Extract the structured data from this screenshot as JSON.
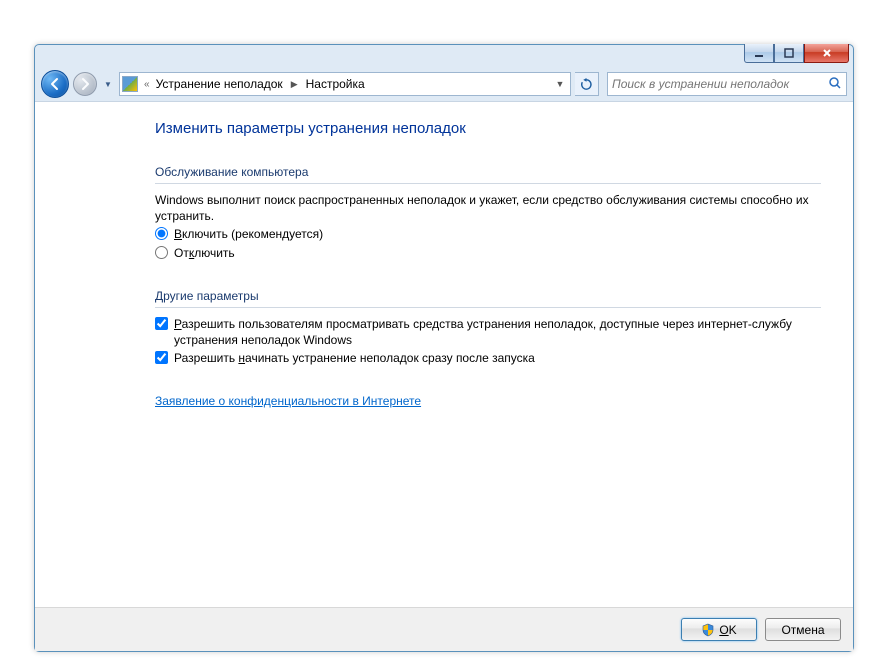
{
  "breadcrumb": {
    "prefix": "«",
    "part1": "Устранение неполадок",
    "part2": "Настройка"
  },
  "search": {
    "placeholder": "Поиск в устранении неполадок"
  },
  "page": {
    "title": "Изменить параметры устранения неполадок"
  },
  "section1": {
    "header": "Обслуживание компьютера",
    "description": "Windows выполнит поиск распространенных неполадок и укажет, если средство обслуживания системы способно их устранить.",
    "radio_on_prefix": "В",
    "radio_on_rest": "ключить (рекомендуется)",
    "radio_off_prefix": "От",
    "radio_off_accessor": "к",
    "radio_off_rest": "лючить"
  },
  "section2": {
    "header": "Другие параметры",
    "check1_prefix": "Р",
    "check1_rest": "азрешить пользователям просматривать средства устранения неполадок, доступные через интернет-службу устранения неполадок Windows",
    "check2_prefix": "Разрешить ",
    "check2_accessor": "н",
    "check2_rest": "ачинать устранение неполадок сразу после запуска"
  },
  "privacy_link": "Заявление о конфиденциальности в Интернете",
  "footer": {
    "ok_accessor": "O",
    "ok_rest": "K",
    "cancel": "Отмена"
  }
}
